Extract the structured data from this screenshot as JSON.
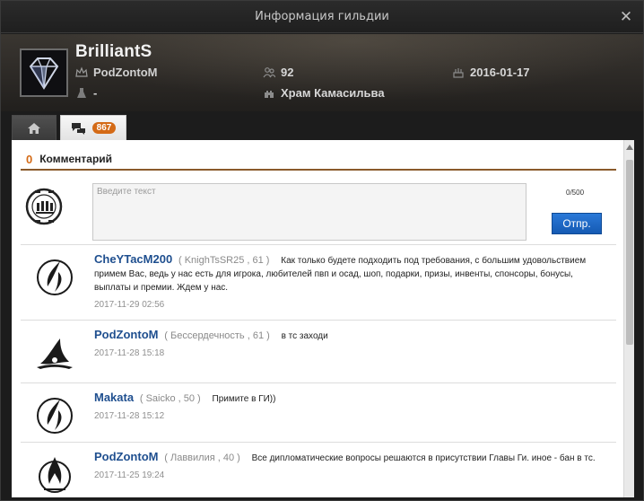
{
  "window": {
    "title": "Информация гильдии"
  },
  "guild": {
    "name": "BrilliantS",
    "leader": "PodZontoM",
    "members": "92",
    "founded": "2016-01-17",
    "alliance": "-",
    "node": "Храм Камасильва"
  },
  "tabs": {
    "comments_badge": "867"
  },
  "comments_section": {
    "count": "0",
    "title": "Комментарий",
    "input_placeholder": "Введите текст",
    "char_counter": "0/500",
    "send_label": "Отпр."
  },
  "comments": [
    {
      "author": "CheYTacM200",
      "character": "( KnighTsSR25 , 61 )",
      "text": "Как только будете подходить под требования, с большим удовольствием примем Вас, ведь у нас есть для игрока, любителей пвп и осад, шоп, подарки, призы, инвенты, спонсоры, бонусы, выплаты и премии. Ждем у нас.",
      "date": "2017-11-29 02:56"
    },
    {
      "author": "PodZontoM",
      "character": "( Бессердечность , 61 )",
      "text": "в тс заходи",
      "date": "2017-11-28 15:18"
    },
    {
      "author": "Makata",
      "character": "( Saicko , 50 )",
      "text": "Примите в ГИ))",
      "date": "2017-11-28 15:12"
    },
    {
      "author": "PodZontoM",
      "character": "( Лаввилия , 40 )",
      "text": "Все дипломатические вопросы решаются в присутствии Главы Ги. иное - бан в тс.",
      "date": "2017-11-25 19:24"
    }
  ],
  "colors": {
    "accent_orange": "#d46a16",
    "author_blue": "#1f4f8f",
    "send_button": "#1c66c4"
  },
  "icons": {
    "close": "close-icon",
    "leader": "crown-icon",
    "members": "members-icon",
    "founded": "cake-icon",
    "alliance": "flask-icon",
    "node": "castle-icon",
    "home": "home-icon",
    "comments": "chat-bubbles-icon"
  }
}
